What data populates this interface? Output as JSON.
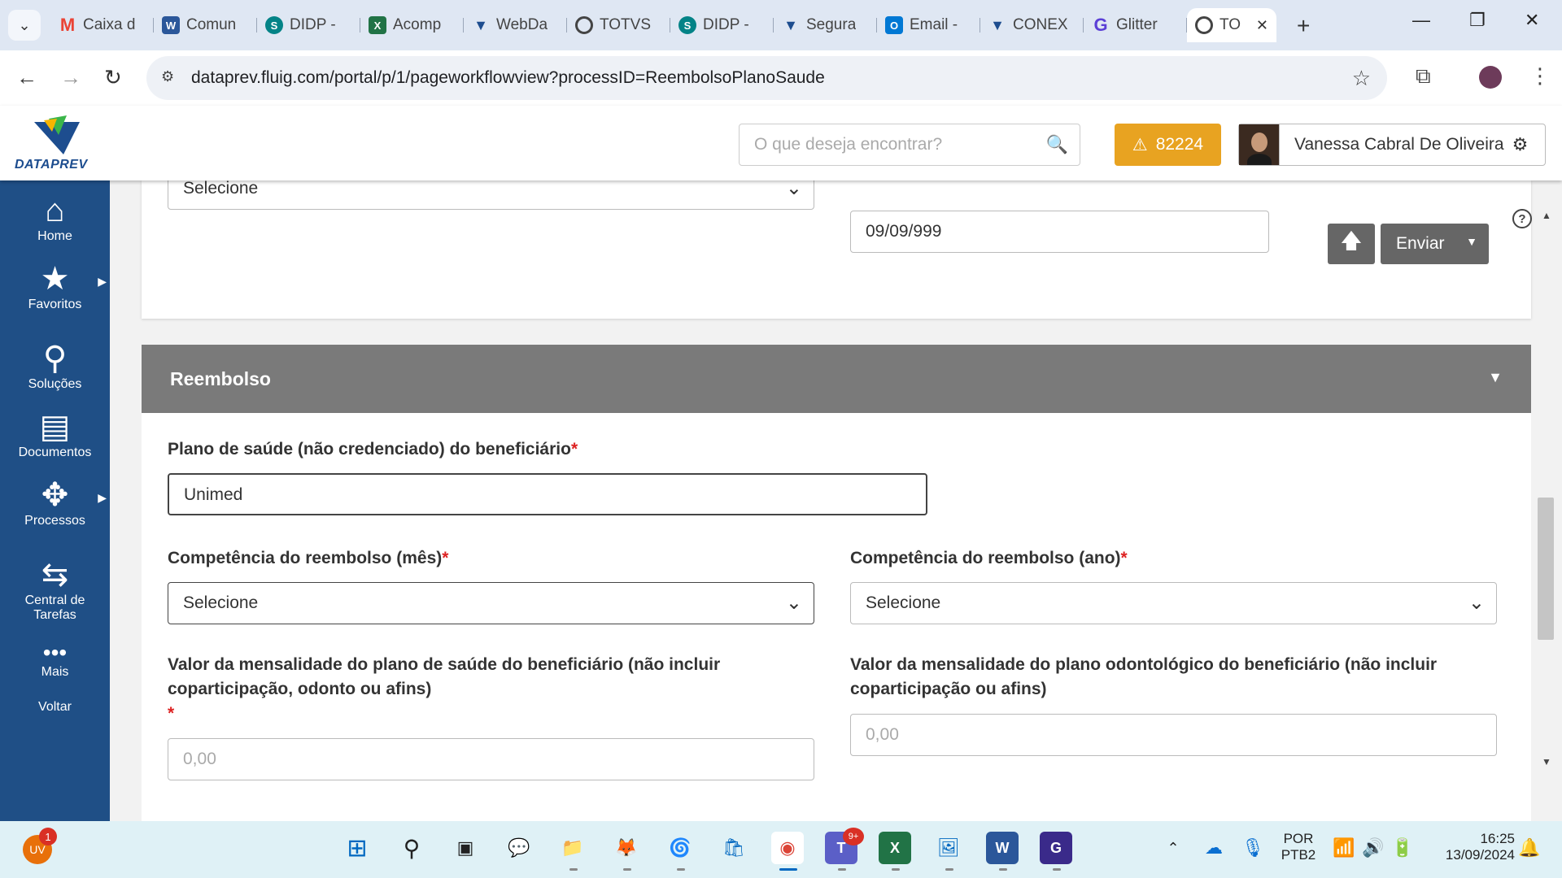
{
  "browser": {
    "tabs": [
      {
        "label": "Caixa d",
        "icon": "gmail-icon",
        "color": "#ea4335"
      },
      {
        "label": "Comun",
        "icon": "word-icon",
        "color": "#2b579a"
      },
      {
        "label": "DIDP -",
        "icon": "sharepoint-icon",
        "color": "#038387"
      },
      {
        "label": "Acomp",
        "icon": "excel-icon",
        "color": "#217346"
      },
      {
        "label": "WebDa",
        "icon": "dataprev-icon",
        "color": "#1d4d8f"
      },
      {
        "label": "TOTVS",
        "icon": "totvs-icon",
        "color": "#444444"
      },
      {
        "label": "DIDP -",
        "icon": "sharepoint-icon",
        "color": "#038387"
      },
      {
        "label": "Segura",
        "icon": "dataprev-icon",
        "color": "#1d4d8f"
      },
      {
        "label": "Email -",
        "icon": "outlook-icon",
        "color": "#0078d4"
      },
      {
        "label": "CONEX",
        "icon": "dataprev-icon",
        "color": "#1d4d8f"
      },
      {
        "label": "Glitter",
        "icon": "glitter-icon",
        "color": "#5b3fd6"
      },
      {
        "label": "TO",
        "icon": "totvs-icon",
        "color": "#444444"
      }
    ],
    "url": "dataprev.fluig.com/portal/p/1/pageworkflowview?processID=ReembolsoPlanoSaude"
  },
  "header": {
    "logo_text": "DATAPREV",
    "search_placeholder": "O que deseja encontrar?",
    "alert_count": "82224",
    "user_name": "Vanessa Cabral De Oliveira"
  },
  "sidebar": {
    "items": [
      {
        "label": "Home",
        "icon": "home-icon"
      },
      {
        "label": "Favoritos",
        "icon": "star-icon"
      },
      {
        "label": "Soluções",
        "icon": "rocket-icon"
      },
      {
        "label": "Documentos",
        "icon": "documents-icon"
      },
      {
        "label": "Processos",
        "icon": "process-icon"
      },
      {
        "label": "Central de Tarefas",
        "icon": "tasks-icon"
      },
      {
        "label": "Mais",
        "icon": "more-icon"
      },
      {
        "label": "Voltar",
        "icon": ""
      }
    ]
  },
  "form": {
    "top_select_value": "Selecione",
    "top_date_value": "09/09/999",
    "send_label": "Enviar",
    "section_title": "Reembolso",
    "plano_label": "Plano de saúde (não credenciado) do beneficiário",
    "plano_value": "Unimed",
    "mes_label": "Competência do reembolso (mês)",
    "mes_value": "Selecione",
    "ano_label": "Competência do reembolso (ano)",
    "ano_value": "Selecione",
    "mensalidade_saude_label": "Valor da mensalidade do plano de saúde do beneficiário (não incluir coparticipação, odonto ou afins)",
    "mensalidade_saude_placeholder": "0,00",
    "mensalidade_odonto_label": "Valor da mensalidade do plano odontológico do beneficiário (não incluir coparticipação ou afins)",
    "mensalidade_odonto_placeholder": "0,00",
    "required_mark": "*"
  },
  "taskbar": {
    "user_initials": "UV",
    "user_badge": "1",
    "teams_badge": "9+",
    "language": "POR",
    "layout": "PTB2",
    "time": "16:25",
    "date": "13/09/2024"
  }
}
